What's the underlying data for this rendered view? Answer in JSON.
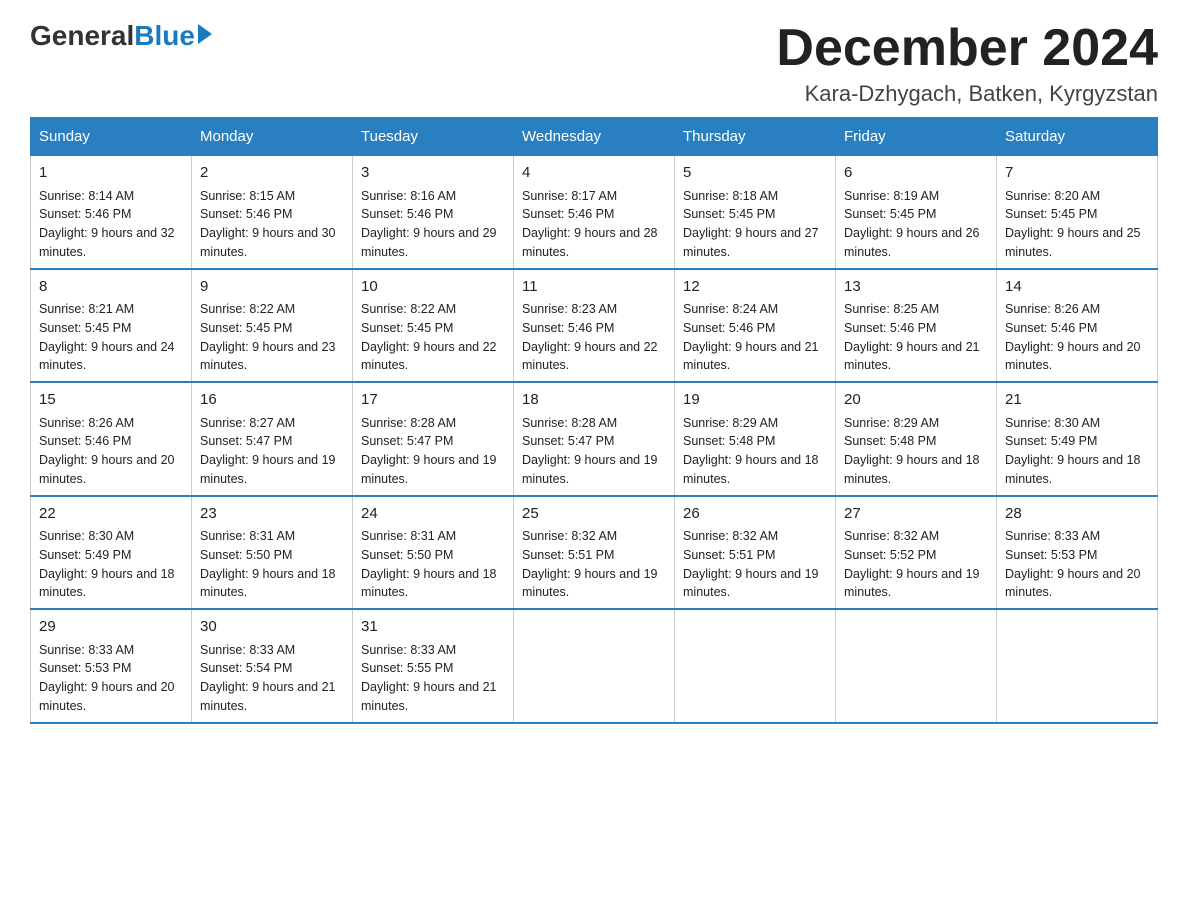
{
  "logo": {
    "general": "General",
    "blue": "Blue"
  },
  "title": "December 2024",
  "subtitle": "Kara-Dzhygach, Batken, Kyrgyzstan",
  "days_of_week": [
    "Sunday",
    "Monday",
    "Tuesday",
    "Wednesday",
    "Thursday",
    "Friday",
    "Saturday"
  ],
  "weeks": [
    [
      {
        "day": "1",
        "sunrise": "8:14 AM",
        "sunset": "5:46 PM",
        "daylight": "9 hours and 32 minutes."
      },
      {
        "day": "2",
        "sunrise": "8:15 AM",
        "sunset": "5:46 PM",
        "daylight": "9 hours and 30 minutes."
      },
      {
        "day": "3",
        "sunrise": "8:16 AM",
        "sunset": "5:46 PM",
        "daylight": "9 hours and 29 minutes."
      },
      {
        "day": "4",
        "sunrise": "8:17 AM",
        "sunset": "5:46 PM",
        "daylight": "9 hours and 28 minutes."
      },
      {
        "day": "5",
        "sunrise": "8:18 AM",
        "sunset": "5:45 PM",
        "daylight": "9 hours and 27 minutes."
      },
      {
        "day": "6",
        "sunrise": "8:19 AM",
        "sunset": "5:45 PM",
        "daylight": "9 hours and 26 minutes."
      },
      {
        "day": "7",
        "sunrise": "8:20 AM",
        "sunset": "5:45 PM",
        "daylight": "9 hours and 25 minutes."
      }
    ],
    [
      {
        "day": "8",
        "sunrise": "8:21 AM",
        "sunset": "5:45 PM",
        "daylight": "9 hours and 24 minutes."
      },
      {
        "day": "9",
        "sunrise": "8:22 AM",
        "sunset": "5:45 PM",
        "daylight": "9 hours and 23 minutes."
      },
      {
        "day": "10",
        "sunrise": "8:22 AM",
        "sunset": "5:45 PM",
        "daylight": "9 hours and 22 minutes."
      },
      {
        "day": "11",
        "sunrise": "8:23 AM",
        "sunset": "5:46 PM",
        "daylight": "9 hours and 22 minutes."
      },
      {
        "day": "12",
        "sunrise": "8:24 AM",
        "sunset": "5:46 PM",
        "daylight": "9 hours and 21 minutes."
      },
      {
        "day": "13",
        "sunrise": "8:25 AM",
        "sunset": "5:46 PM",
        "daylight": "9 hours and 21 minutes."
      },
      {
        "day": "14",
        "sunrise": "8:26 AM",
        "sunset": "5:46 PM",
        "daylight": "9 hours and 20 minutes."
      }
    ],
    [
      {
        "day": "15",
        "sunrise": "8:26 AM",
        "sunset": "5:46 PM",
        "daylight": "9 hours and 20 minutes."
      },
      {
        "day": "16",
        "sunrise": "8:27 AM",
        "sunset": "5:47 PM",
        "daylight": "9 hours and 19 minutes."
      },
      {
        "day": "17",
        "sunrise": "8:28 AM",
        "sunset": "5:47 PM",
        "daylight": "9 hours and 19 minutes."
      },
      {
        "day": "18",
        "sunrise": "8:28 AM",
        "sunset": "5:47 PM",
        "daylight": "9 hours and 19 minutes."
      },
      {
        "day": "19",
        "sunrise": "8:29 AM",
        "sunset": "5:48 PM",
        "daylight": "9 hours and 18 minutes."
      },
      {
        "day": "20",
        "sunrise": "8:29 AM",
        "sunset": "5:48 PM",
        "daylight": "9 hours and 18 minutes."
      },
      {
        "day": "21",
        "sunrise": "8:30 AM",
        "sunset": "5:49 PM",
        "daylight": "9 hours and 18 minutes."
      }
    ],
    [
      {
        "day": "22",
        "sunrise": "8:30 AM",
        "sunset": "5:49 PM",
        "daylight": "9 hours and 18 minutes."
      },
      {
        "day": "23",
        "sunrise": "8:31 AM",
        "sunset": "5:50 PM",
        "daylight": "9 hours and 18 minutes."
      },
      {
        "day": "24",
        "sunrise": "8:31 AM",
        "sunset": "5:50 PM",
        "daylight": "9 hours and 18 minutes."
      },
      {
        "day": "25",
        "sunrise": "8:32 AM",
        "sunset": "5:51 PM",
        "daylight": "9 hours and 19 minutes."
      },
      {
        "day": "26",
        "sunrise": "8:32 AM",
        "sunset": "5:51 PM",
        "daylight": "9 hours and 19 minutes."
      },
      {
        "day": "27",
        "sunrise": "8:32 AM",
        "sunset": "5:52 PM",
        "daylight": "9 hours and 19 minutes."
      },
      {
        "day": "28",
        "sunrise": "8:33 AM",
        "sunset": "5:53 PM",
        "daylight": "9 hours and 20 minutes."
      }
    ],
    [
      {
        "day": "29",
        "sunrise": "8:33 AM",
        "sunset": "5:53 PM",
        "daylight": "9 hours and 20 minutes."
      },
      {
        "day": "30",
        "sunrise": "8:33 AM",
        "sunset": "5:54 PM",
        "daylight": "9 hours and 21 minutes."
      },
      {
        "day": "31",
        "sunrise": "8:33 AM",
        "sunset": "5:55 PM",
        "daylight": "9 hours and 21 minutes."
      },
      {
        "day": "",
        "sunrise": "",
        "sunset": "",
        "daylight": ""
      },
      {
        "day": "",
        "sunrise": "",
        "sunset": "",
        "daylight": ""
      },
      {
        "day": "",
        "sunrise": "",
        "sunset": "",
        "daylight": ""
      },
      {
        "day": "",
        "sunrise": "",
        "sunset": "",
        "daylight": ""
      }
    ]
  ],
  "labels": {
    "sunrise_prefix": "Sunrise: ",
    "sunset_prefix": "Sunset: ",
    "daylight_prefix": "Daylight: "
  }
}
